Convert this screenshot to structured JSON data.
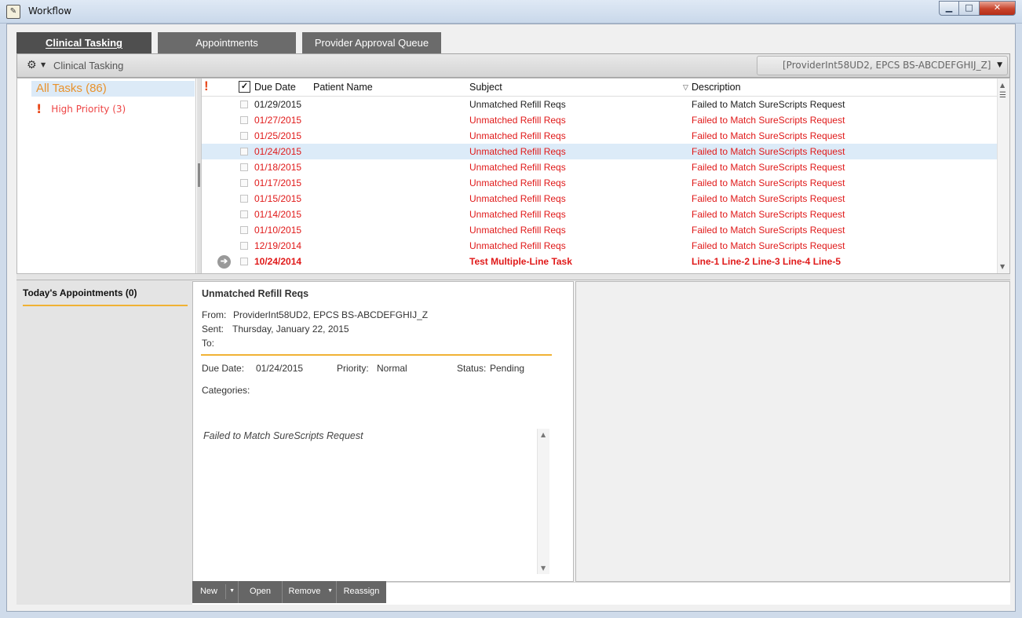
{
  "window": {
    "title": "Workflow",
    "app_icon": "notepad-icon",
    "controls": {
      "minimize": "▁",
      "maximize": "□",
      "close": "✕"
    }
  },
  "tabs": [
    {
      "label": "Clinical Tasking",
      "active": true
    },
    {
      "label": "Appointments",
      "active": false
    },
    {
      "label": "Provider Approval Queue",
      "active": false
    }
  ],
  "toolbar": {
    "gear_icon": "gear-icon",
    "title": "Clinical Tasking",
    "provider_select": "[ProviderInt58UD2, EPCS BS-ABCDEFGHIJ_Z]"
  },
  "nav": {
    "all_tasks": "All Tasks (86)",
    "high_priority": "High Priority (3)"
  },
  "grid": {
    "columns": {
      "priority_icon": "!",
      "check_icon": "✓",
      "due_date": "Due Date",
      "patient_name": "Patient Name",
      "subject": "Subject",
      "sort_indicator": "▽",
      "description": "Description"
    },
    "rows": [
      {
        "due": "01/29/2015",
        "subject": "Unmatched Refill Reqs",
        "description": "Failed to Match SureScripts Request",
        "style": "normal"
      },
      {
        "due": "01/27/2015",
        "subject": "Unmatched Refill Reqs",
        "description": "Failed to Match SureScripts Request",
        "style": "red"
      },
      {
        "due": "01/25/2015",
        "subject": "Unmatched Refill Reqs",
        "description": "Failed to Match SureScripts Request",
        "style": "red"
      },
      {
        "due": "01/24/2015",
        "subject": "Unmatched Refill Reqs",
        "description": "Failed to Match SureScripts Request",
        "style": "red",
        "selected": true
      },
      {
        "due": "01/18/2015",
        "subject": "Unmatched Refill Reqs",
        "description": "Failed to Match SureScripts Request",
        "style": "red"
      },
      {
        "due": "01/17/2015",
        "subject": "Unmatched Refill Reqs",
        "description": "Failed to Match SureScripts Request",
        "style": "red"
      },
      {
        "due": "01/15/2015",
        "subject": "Unmatched Refill Reqs",
        "description": "Failed to Match SureScripts Request",
        "style": "red"
      },
      {
        "due": "01/14/2015",
        "subject": "Unmatched Refill Reqs",
        "description": "Failed to Match SureScripts Request",
        "style": "red"
      },
      {
        "due": "01/10/2015",
        "subject": "Unmatched Refill Reqs",
        "description": "Failed to Match SureScripts Request",
        "style": "red"
      },
      {
        "due": "12/19/2014",
        "subject": "Unmatched Refill Reqs",
        "description": "Failed to Match SureScripts Request",
        "style": "red"
      },
      {
        "due": "10/24/2014",
        "subject": "Test Multiple-Line Task",
        "description": "Line-1 Line-2 Line-3 Line-4 Line-5",
        "style": "red-bold",
        "icon": "forward-arrow-icon"
      }
    ]
  },
  "appointments": {
    "header": "Today's Appointments (0)"
  },
  "preview": {
    "subject": "Unmatched Refill Reqs",
    "from_label": "From:",
    "from_value": "ProviderInt58UD2, EPCS BS-ABCDEFGHIJ_Z",
    "sent_label": "Sent:",
    "sent_value": "Thursday, January 22, 2015",
    "to_label": "To:",
    "due_label": "Due Date:",
    "due_value": "01/24/2015",
    "priority_label": "Priority:",
    "priority_value": "Normal",
    "status_label": "Status:",
    "status_value": "Pending",
    "categories_label": "Categories:",
    "body": "Failed to Match SureScripts Request"
  },
  "actions": {
    "new": "New",
    "open": "Open",
    "remove": "Remove",
    "reassign": "Reassign"
  }
}
